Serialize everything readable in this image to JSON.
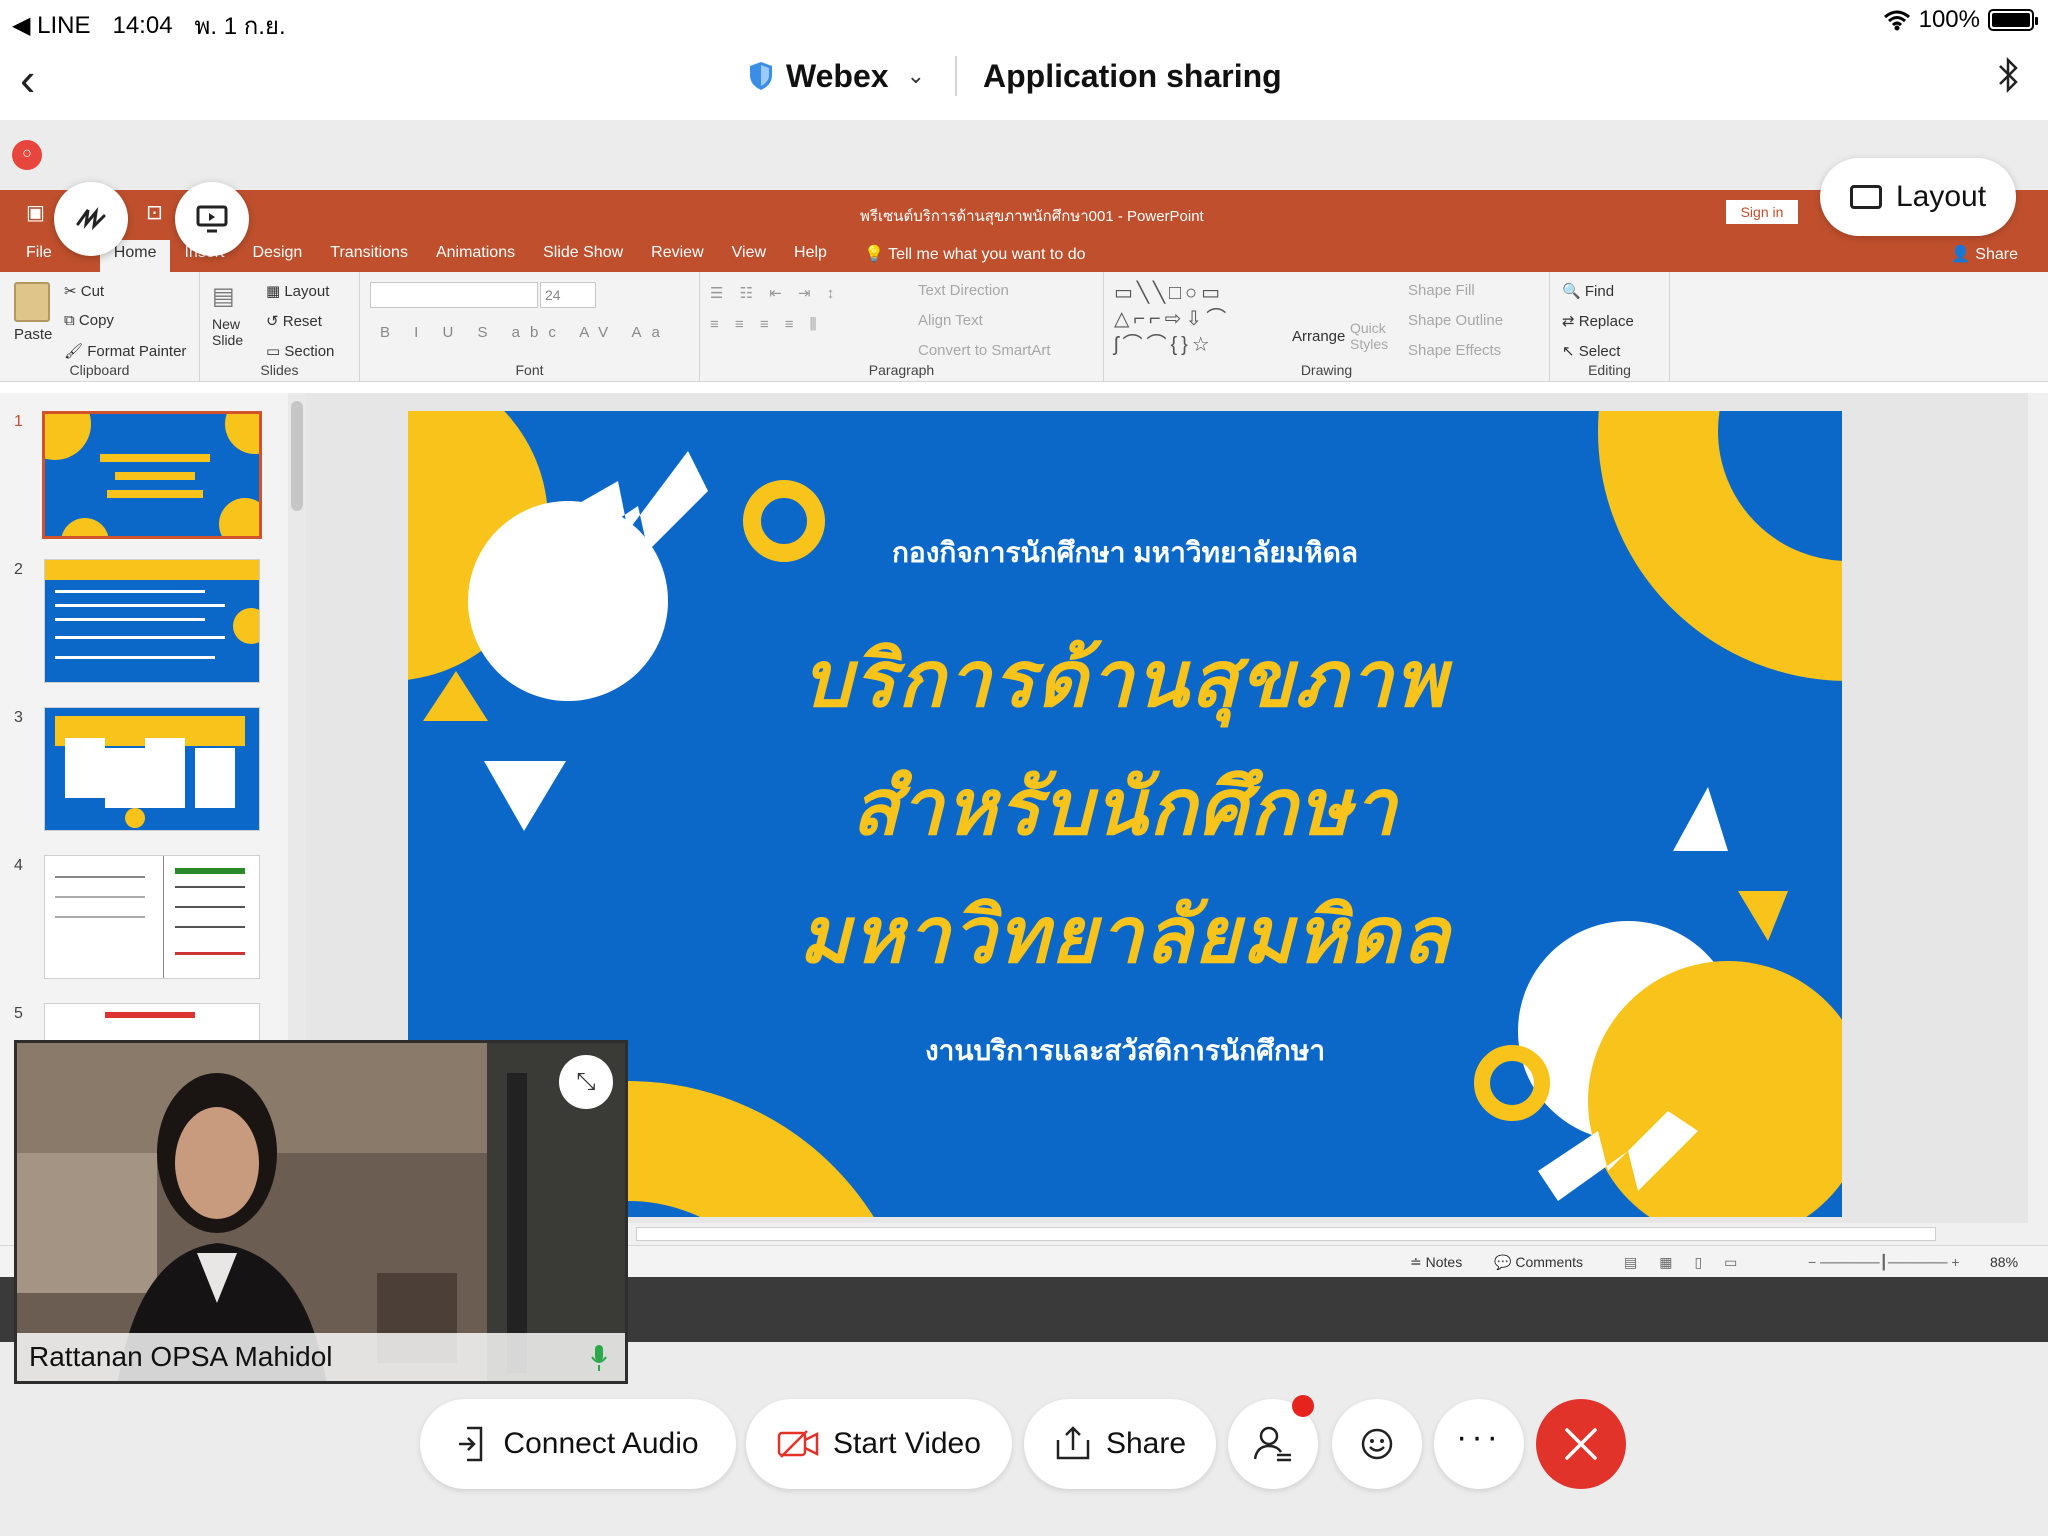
{
  "status_bar": {
    "back_app": "◀ LINE",
    "time": "14:04",
    "date": "พ. 1 ก.ย.",
    "battery": "100%",
    "battery_level_percent": 100
  },
  "header": {
    "brand": "Webex",
    "title": "Application sharing"
  },
  "layout_button": {
    "label": "Layout"
  },
  "ppt": {
    "window_title": "พรีเซนต์บริการด้านสุขภาพนักศึกษา001 - PowerPoint",
    "sign_in": "Sign in",
    "tabs": [
      "File",
      "Home",
      "Insert",
      "Design",
      "Transitions",
      "Animations",
      "Slide Show",
      "Review",
      "View",
      "Help"
    ],
    "tell_me": "Tell me what you want to do",
    "share": "Share",
    "ribbon": {
      "clipboard": {
        "paste": "Paste",
        "cut": "Cut",
        "copy": "Copy",
        "format_painter": "Format Painter",
        "label": "Clipboard"
      },
      "slides": {
        "new_slide": "New Slide",
        "layout": "Layout",
        "reset": "Reset",
        "section": "Section",
        "label": "Slides"
      },
      "font": {
        "size": "24",
        "label": "Font"
      },
      "paragraph": {
        "text_direction": "Text Direction",
        "align_text": "Align Text",
        "convert_smartart": "Convert to SmartArt",
        "label": "Paragraph"
      },
      "drawing": {
        "arrange": "Arrange",
        "quick_styles": "Quick Styles",
        "shape_fill": "Shape Fill",
        "shape_outline": "Shape Outline",
        "shape_effects": "Shape Effects",
        "label": "Drawing"
      },
      "editing": {
        "find": "Find",
        "replace": "Replace",
        "select": "Select",
        "label": "Editing"
      }
    },
    "thumb_numbers": [
      "1",
      "2",
      "3",
      "4",
      "5"
    ],
    "slide": {
      "org": "กองกิจการนักศึกษา มหาวิทยาลัยมหิดล",
      "line1": "บริการด้านสุขภาพ",
      "line2": "สำหรับนักศึกษา",
      "line3": "มหาวิทยาลัยมหิดล",
      "unit": "งานบริการและสวัสดิการนักศึกษา"
    },
    "status": {
      "notes": "Notes",
      "comments": "Comments",
      "zoom": "88%"
    }
  },
  "video": {
    "participant": "Rattanan OPSA Mahidol"
  },
  "controls": {
    "connect_audio": "Connect Audio",
    "start_video": "Start Video",
    "share": "Share"
  },
  "colors": {
    "ppt_accent": "#c0502d",
    "slide_blue": "#0b68c9",
    "slide_yellow": "#f8c31a",
    "end_call_red": "#e1332a"
  }
}
